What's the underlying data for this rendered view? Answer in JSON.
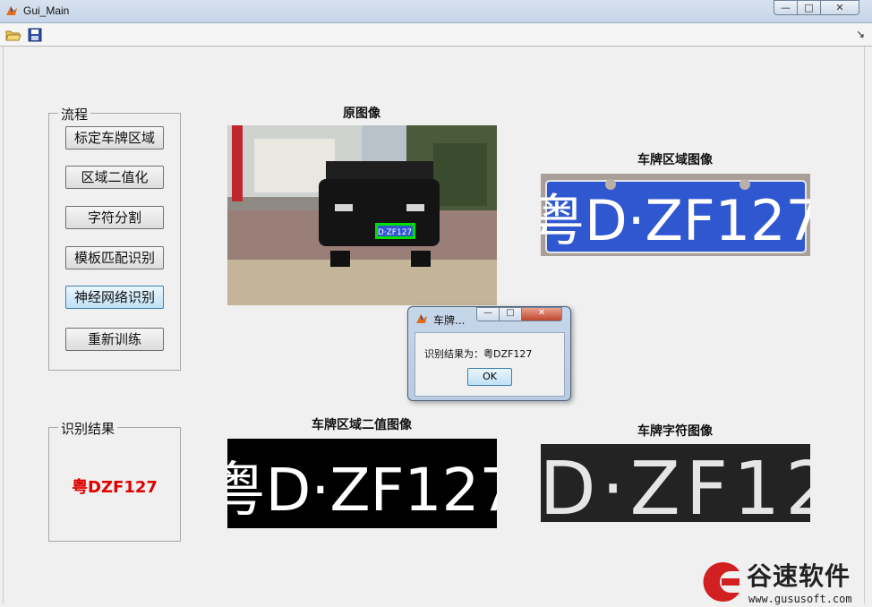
{
  "window": {
    "title": "Gui_Main",
    "minimize": "—",
    "maximize": "□",
    "close": "✕"
  },
  "toolbar": {
    "open_icon": "folder-open-icon",
    "save_icon": "save-icon",
    "arrow": "↘"
  },
  "process_panel": {
    "label": "流程",
    "buttons": [
      "标定车牌区域",
      "区域二值化",
      "字符分割",
      "模板匹配识别",
      "神经网络识别",
      "重新训练"
    ]
  },
  "result_panel": {
    "label": "识别结果",
    "value": "粤DZF127"
  },
  "images": {
    "original_title": "原图像",
    "plate_region_title": "车牌区域图像",
    "binary_title": "车牌区域二值图像",
    "chars_title": "车牌字符图像",
    "plate_text": "粤D·ZF127"
  },
  "dialog": {
    "title": "车牌...",
    "message": "识别结果为：粤DZF127",
    "ok": "OK"
  },
  "watermark": {
    "cn": "谷速软件",
    "url": "www.gususoft.com"
  },
  "colors": {
    "result_red": "#e00000",
    "plate_blue": "#2f57d0"
  }
}
